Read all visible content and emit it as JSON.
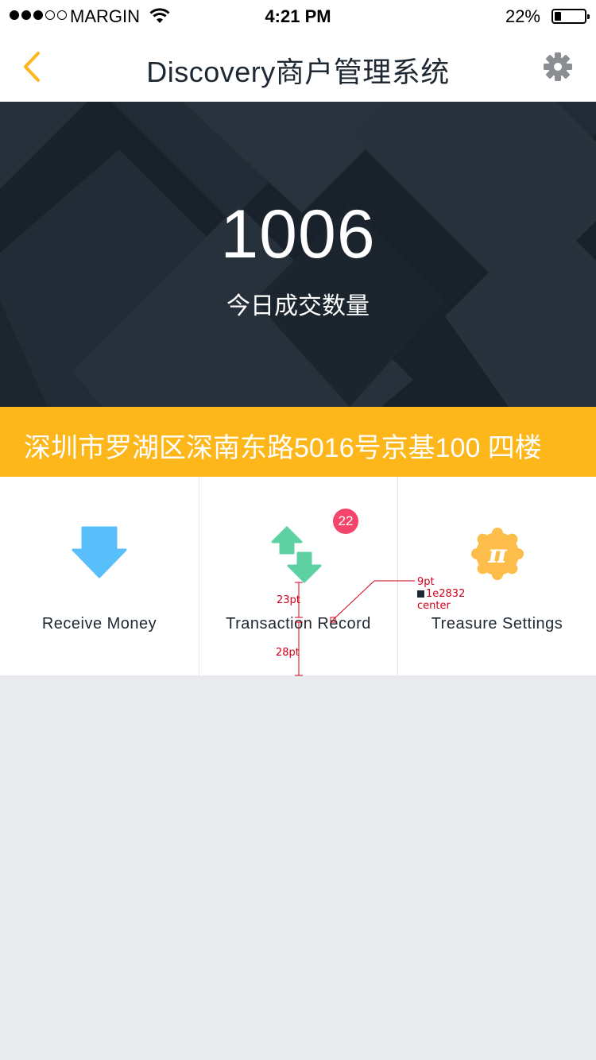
{
  "status_bar": {
    "carrier": "MARGIN",
    "time": "4:21 PM",
    "battery": "22%",
    "battery_level": 0.22
  },
  "nav": {
    "title": "Discovery商户管理系统",
    "back_icon": "chevron-left-icon",
    "settings_icon": "gear-icon",
    "accent_color": "#fdb71a"
  },
  "hero": {
    "count": "1006",
    "label": "今日成交数量"
  },
  "address": {
    "text": "深圳市罗湖区深南东路5016号京基100 四楼",
    "color": "#fdb71a"
  },
  "actions": [
    {
      "label": "Receive Money",
      "icon": "arrow-down-icon",
      "color": "#59bffb"
    },
    {
      "label": "Transaction Record",
      "icon": "transfer-arrows-icon",
      "color": "#5ed1a3",
      "badge": "22"
    },
    {
      "label": "Treasure Settings",
      "icon": "pi-badge-icon",
      "color": "#fdbd4b"
    }
  ],
  "annotations": {
    "gap_top": "23pt",
    "gap_bottom": "28pt",
    "font_size": "9pt",
    "color_hex": "1e2832",
    "align": "center"
  }
}
